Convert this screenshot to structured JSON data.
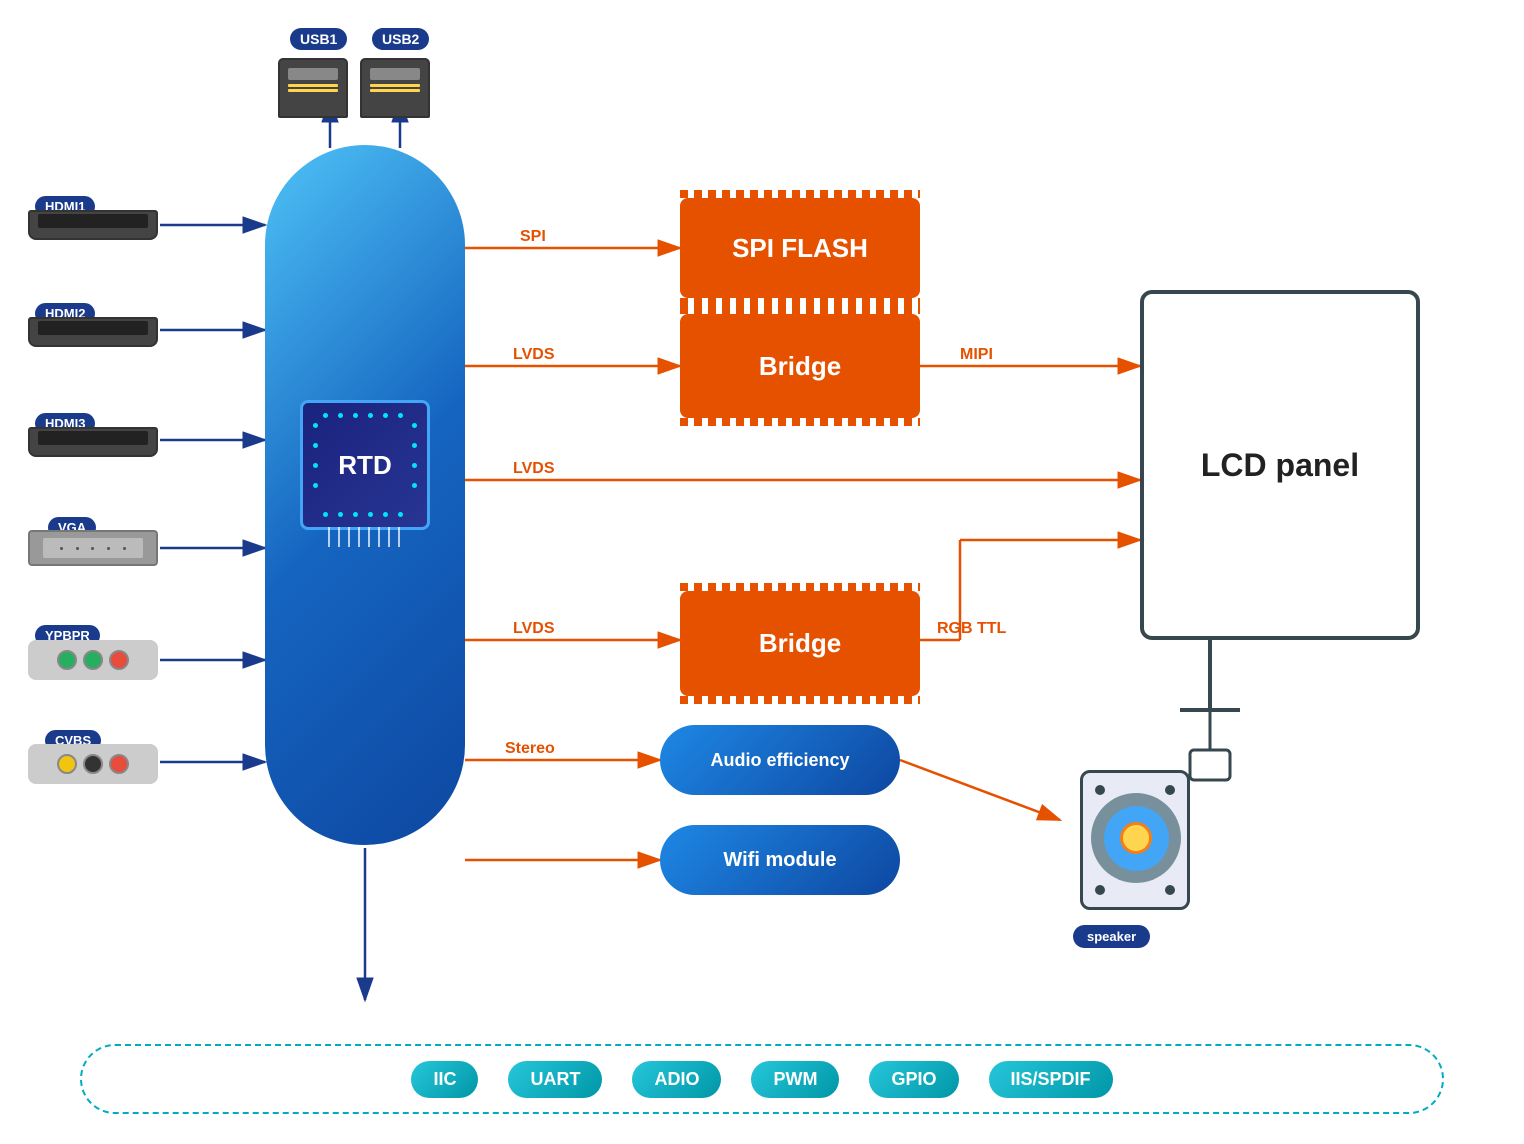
{
  "usb": {
    "usb1_label": "USB1",
    "usb2_label": "USB2"
  },
  "rtd": {
    "chip_label": "RTD"
  },
  "components": {
    "spi_flash": "SPI FLASH",
    "bridge1": "Bridge",
    "bridge2": "Bridge",
    "audio": "Audio efficiency",
    "wifi": "Wifi module",
    "lcd": "LCD panel"
  },
  "signals": {
    "spi": "SPI",
    "lvds1": "LVDS",
    "lvds2": "LVDS",
    "lvds3": "LVDS",
    "stereo": "Stereo",
    "mipi": "MIPI",
    "rgb_ttl": "RGB TTL"
  },
  "inputs": {
    "hdmi1": "HDMI1",
    "hdmi2": "HDMI2",
    "hdmi3": "HDMI3",
    "vga": "VGA",
    "ypbpr": "YPBPR",
    "cvbs": "CVBS"
  },
  "interfaces": {
    "iic": "IIC",
    "uart": "UART",
    "adio": "ADIO",
    "pwm": "PWM",
    "gpio": "GPIO",
    "iis_spdif": "IIS/SPDIF"
  },
  "output": {
    "speaker": "speaker"
  },
  "colors": {
    "blue_dark": "#1a3a8c",
    "blue_accent": "#1e88e5",
    "orange": "#e65100",
    "teal": "#00acc1"
  }
}
